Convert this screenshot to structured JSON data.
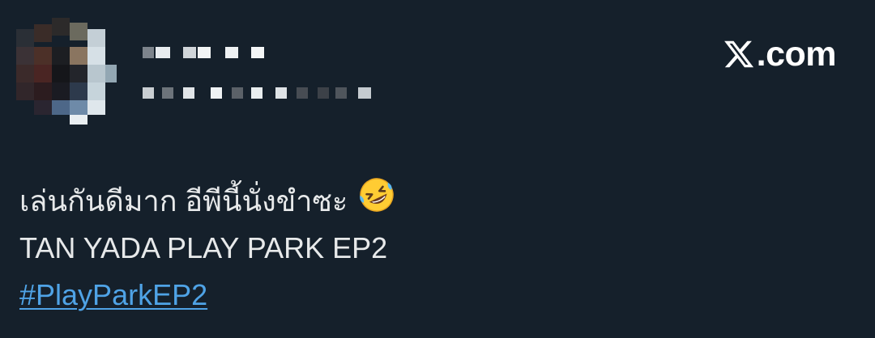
{
  "brand": {
    "logo_icon": "x-logo-icon",
    "domain_text": ".com"
  },
  "author": {
    "avatar_censored": true,
    "name_censored": true
  },
  "tweet": {
    "line1_text": "เล่นกันดีมาก อีพีนี้นั่งขำซะ",
    "line1_emoji": "rolling-on-the-floor-laughing-emoji",
    "line2_text": "TAN YADA PLAY PARK EP2",
    "hashtag": "#PlayParkEP2"
  },
  "colors": {
    "background": "#15202b",
    "text": "#e7e9ea",
    "hashtag": "#4fa3e6",
    "brand": "#ffffff"
  }
}
